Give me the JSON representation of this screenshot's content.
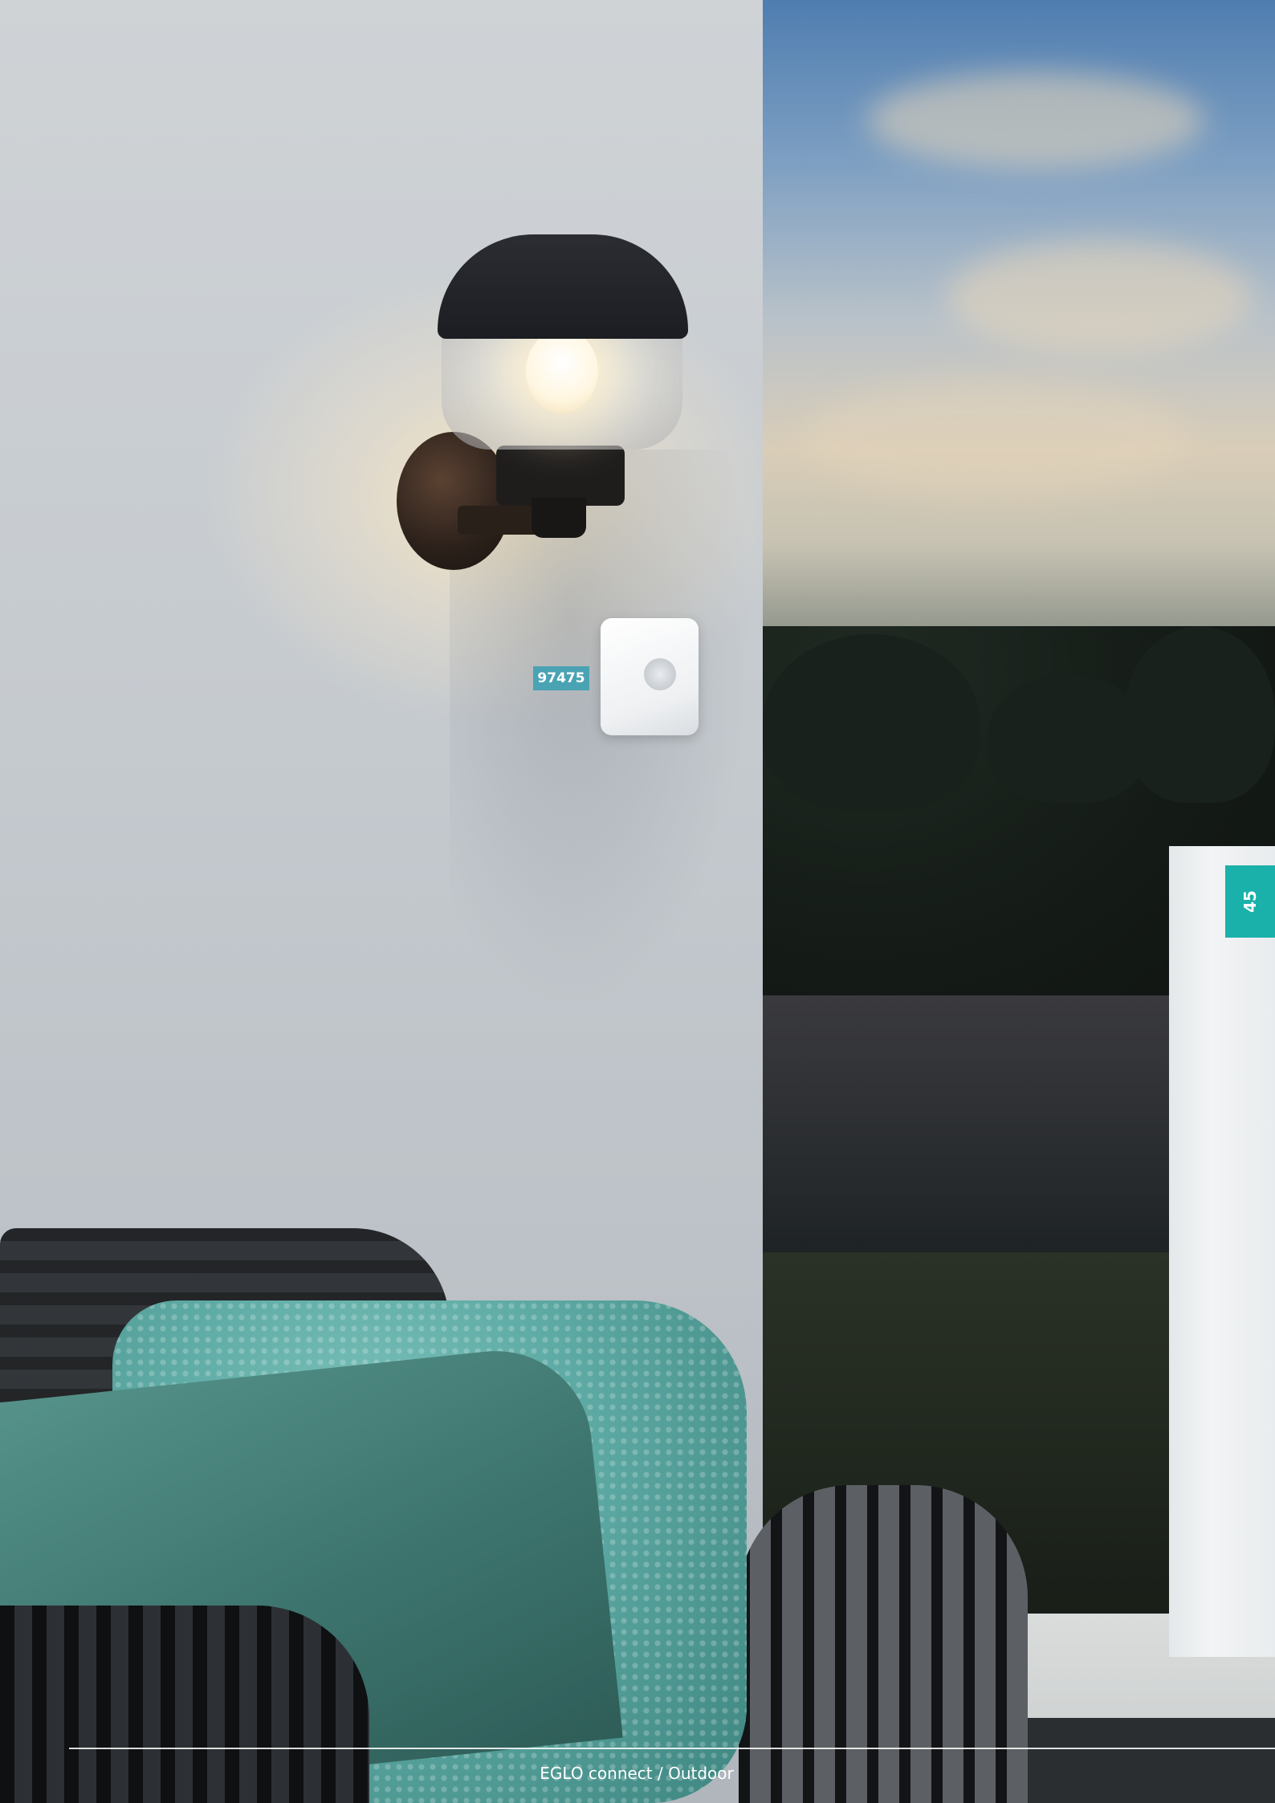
{
  "product": {
    "code": "97475"
  },
  "page": {
    "number": "45",
    "footer": "EGLO connect / Outdoor"
  },
  "colors": {
    "accent": "#1ab1aa",
    "label_bg": "#4aa3b3",
    "text": "#ffffff"
  }
}
